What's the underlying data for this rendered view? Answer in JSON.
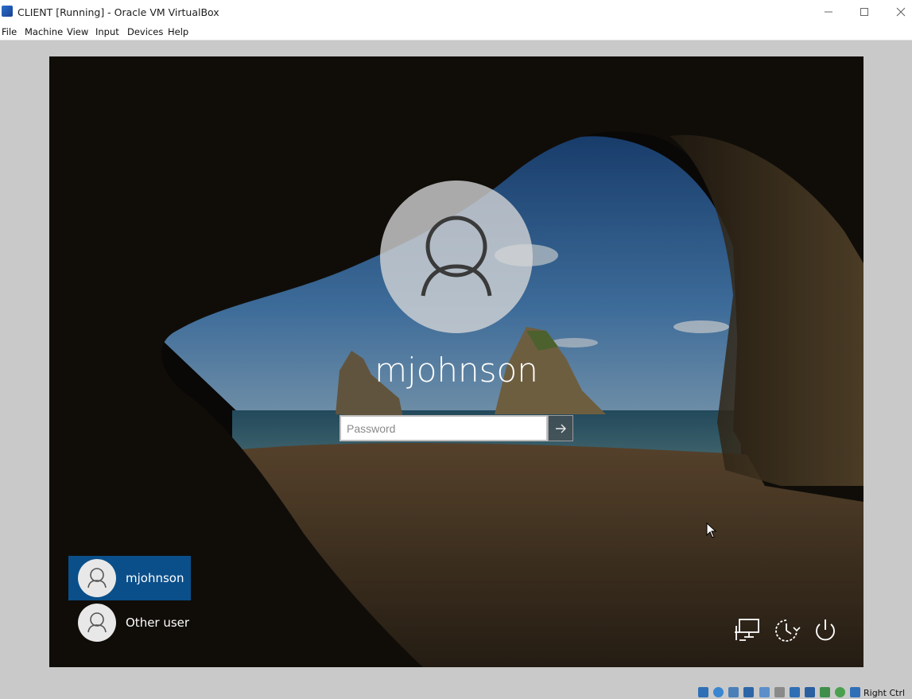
{
  "window": {
    "title": "CLIENT [Running] - Oracle VM VirtualBox",
    "app_icon": "virtualbox-icon",
    "controls": [
      "minimize-icon",
      "maximize-icon",
      "close-icon"
    ]
  },
  "menubar": {
    "items": [
      "File",
      "Machine",
      "View",
      "Input",
      "Devices",
      "Help"
    ]
  },
  "login": {
    "username": "mjohnson",
    "password": {
      "value": "",
      "placeholder": "Password"
    },
    "submit_icon": "arrow-right-icon",
    "users": [
      {
        "name": "mjohnson",
        "selected": true
      },
      {
        "name": "Other user",
        "selected": false
      }
    ],
    "system_buttons": [
      "network-icon",
      "accessibility-icon",
      "power-icon"
    ]
  },
  "statusbar": {
    "icons": [
      "hard-disk-icon",
      "optical-drive-icon",
      "audio-icon",
      "network-adapter-icon",
      "usb-icon",
      "shared-folders-icon",
      "display-icon",
      "video-capture-icon",
      "cpu-icon",
      "mouse-integration-icon",
      "keyboard-icon"
    ],
    "host_key": "Right Ctrl"
  },
  "colors": {
    "selected_tile": "#0a4f8a",
    "screen_bg": "#0c0b09"
  }
}
